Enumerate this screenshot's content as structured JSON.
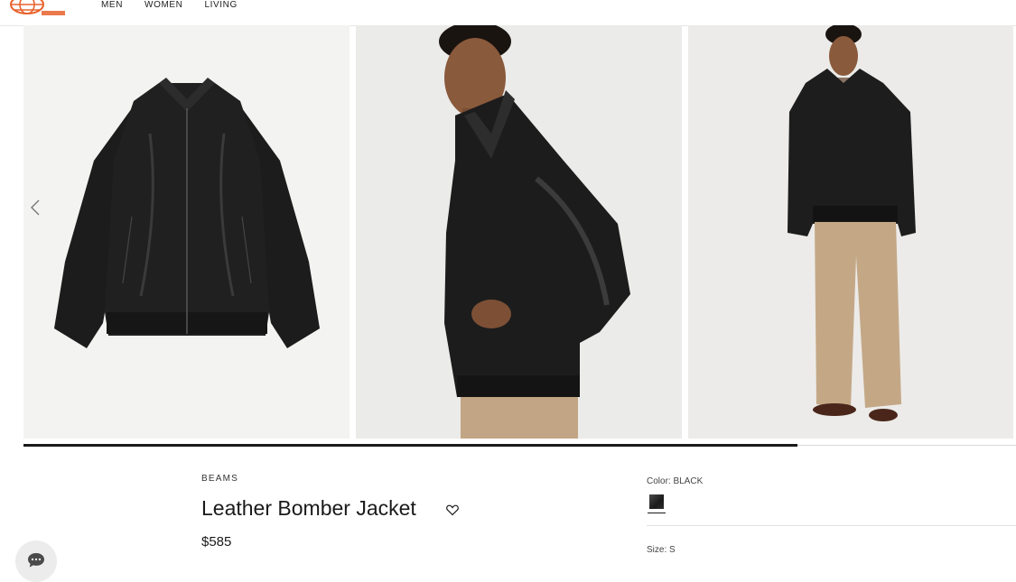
{
  "header": {
    "nav": [
      {
        "label": "MEN"
      },
      {
        "label": "WOMEN"
      },
      {
        "label": "LIVING"
      }
    ]
  },
  "gallery": {
    "progress_fraction": 0.78,
    "icons": {
      "prev": "chevron-left-icon"
    }
  },
  "product": {
    "brand": "BEAMS",
    "title": "Leather Bomber Jacket",
    "price": "$585",
    "color_label": "Color: BLACK",
    "size_label": "Size:  S",
    "swatch_color": "#1b1b1b"
  },
  "icons": {
    "wishlist": "heart-icon",
    "chat": "chat-bubble-icon",
    "logo": "beams-globe-logo"
  },
  "colors": {
    "logo_orange": "#e8622c",
    "text": "#1a1a1a"
  }
}
